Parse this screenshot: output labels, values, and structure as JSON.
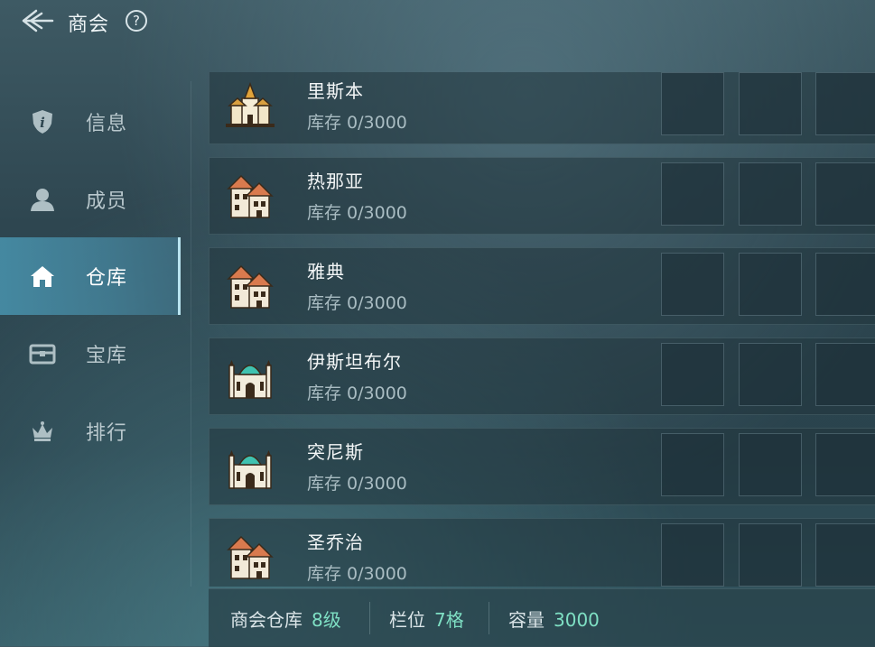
{
  "header": {
    "title": "商会",
    "help": "?"
  },
  "sidebar": {
    "items": [
      {
        "label": "信息",
        "icon": "info-shield-icon",
        "active": false
      },
      {
        "label": "成员",
        "icon": "user-icon",
        "active": false
      },
      {
        "label": "仓库",
        "icon": "home-icon",
        "active": true
      },
      {
        "label": "宝库",
        "icon": "chest-icon",
        "active": false
      },
      {
        "label": "排行",
        "icon": "crown-icon",
        "active": false
      }
    ]
  },
  "warehouses": [
    {
      "name": "里斯本",
      "stock": "库存 0/3000",
      "icon": "cathedral-city-icon"
    },
    {
      "name": "热那亚",
      "stock": "库存 0/3000",
      "icon": "european-houses-icon"
    },
    {
      "name": "雅典",
      "stock": "库存 0/3000",
      "icon": "european-houses-icon"
    },
    {
      "name": "伊斯坦布尔",
      "stock": "库存 0/3000",
      "icon": "mosque-icon"
    },
    {
      "name": "突尼斯",
      "stock": "库存 0/3000",
      "icon": "mosque-icon"
    },
    {
      "name": "圣乔治",
      "stock": "库存 0/3000",
      "icon": "european-houses-icon"
    }
  ],
  "footer": {
    "warehouse_label": "商会仓库",
    "warehouse_level": "8级",
    "slots_label": "栏位",
    "slots_value": "7格",
    "capacity_label": "容量",
    "capacity_value": "3000"
  },
  "colors": {
    "accent_value": "#7fe0c4",
    "active_tab": "#4a8ca5"
  }
}
